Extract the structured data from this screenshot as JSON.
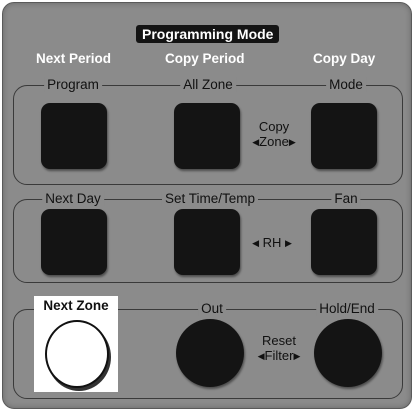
{
  "header": {
    "programming_mode": "Programming Mode",
    "next_period": "Next Period",
    "copy_period": "Copy Period",
    "copy_day": "Copy Day"
  },
  "row1": {
    "program": "Program",
    "all_zone": "All Zone",
    "mode": "Mode",
    "copy_zone_line1": "Copy",
    "copy_zone_line2": "Zone"
  },
  "row2": {
    "next_day": "Next Day",
    "set_time_temp": "Set Time/Temp",
    "fan": "Fan",
    "rh": "RH"
  },
  "row3": {
    "next_zone": "Next Zone",
    "out": "Out",
    "hold_end": "Hold/End",
    "reset_filter_line1": "Reset",
    "reset_filter_line2": "Filter"
  },
  "colors": {
    "panel": "#8b8b8b",
    "button": "#141414",
    "text_light": "#ffffff"
  }
}
